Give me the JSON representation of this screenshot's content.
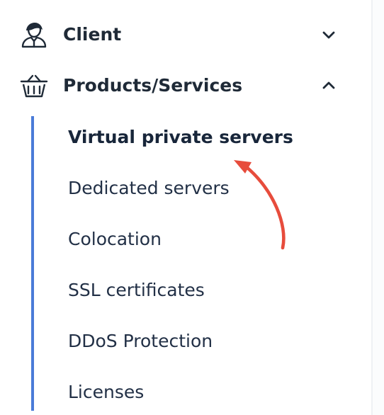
{
  "menu": {
    "client": {
      "label": "Client",
      "icon": "user-icon",
      "state_icon": "chevron-down-icon",
      "expanded": false
    },
    "products": {
      "label": "Products/Services",
      "icon": "basket-icon",
      "state_icon": "chevron-up-icon",
      "expanded": true,
      "items": [
        {
          "label": "Virtual private servers",
          "active": true
        },
        {
          "label": "Dedicated servers",
          "active": false
        },
        {
          "label": "Colocation",
          "active": false
        },
        {
          "label": "SSL certificates",
          "active": false
        },
        {
          "label": "DDoS Protection",
          "active": false
        },
        {
          "label": "Licenses",
          "active": false
        }
      ]
    }
  },
  "colors": {
    "submenu_indicator": "#4a7bd8",
    "annotation_arrow": "#e74c3c",
    "text": "#1f2a37"
  }
}
